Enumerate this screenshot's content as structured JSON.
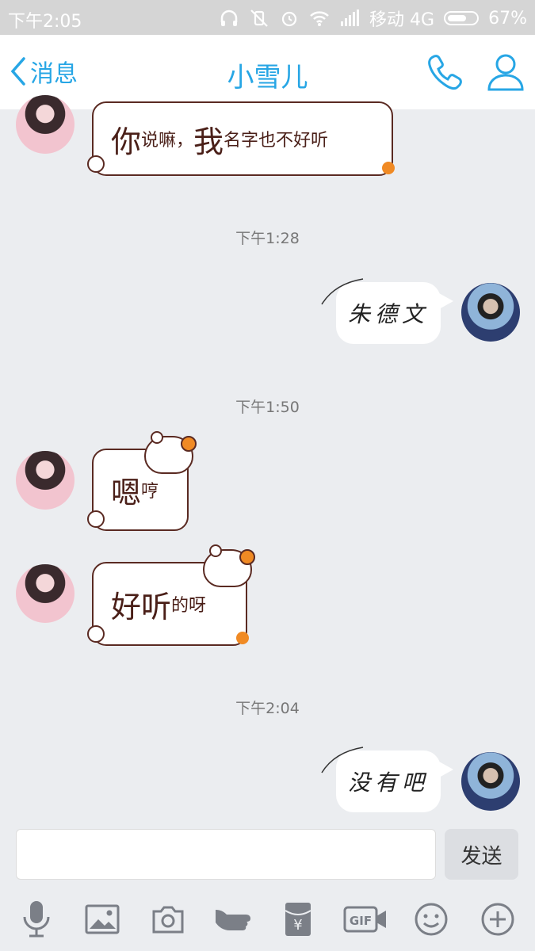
{
  "status_bar": {
    "time": "下午2:05",
    "carrier": "移动 4G",
    "battery": "67%",
    "battery_level": 0.67
  },
  "header": {
    "back_label": "消息",
    "contact_name": "小雪儿",
    "call_icon": "phone-icon",
    "profile_icon": "person-icon"
  },
  "messages": [
    {
      "side": "left",
      "parts": [
        "你",
        "说嘛，",
        "我",
        "名字也不好听"
      ]
    },
    {
      "timestamp": "下午1:28"
    },
    {
      "side": "right",
      "text": "朱德文"
    },
    {
      "timestamp": "下午1:50"
    },
    {
      "side": "left",
      "parts": [
        "嗯",
        "哼"
      ]
    },
    {
      "side": "left",
      "parts": [
        "好听",
        "的呀"
      ]
    },
    {
      "timestamp": "下午2:04"
    },
    {
      "side": "right",
      "text": "没有吧"
    }
  ],
  "composer": {
    "input_value": "",
    "send_label": "发送"
  },
  "toolbar_icons": [
    "microphone-icon",
    "image-icon",
    "camera-icon",
    "poke-hand-icon",
    "red-packet-icon",
    "gif-icon",
    "emoji-icon",
    "plus-icon"
  ],
  "colors": {
    "accent": "#27a6e5",
    "bubble_border": "#5a2a22",
    "background": "#ebedf0"
  }
}
